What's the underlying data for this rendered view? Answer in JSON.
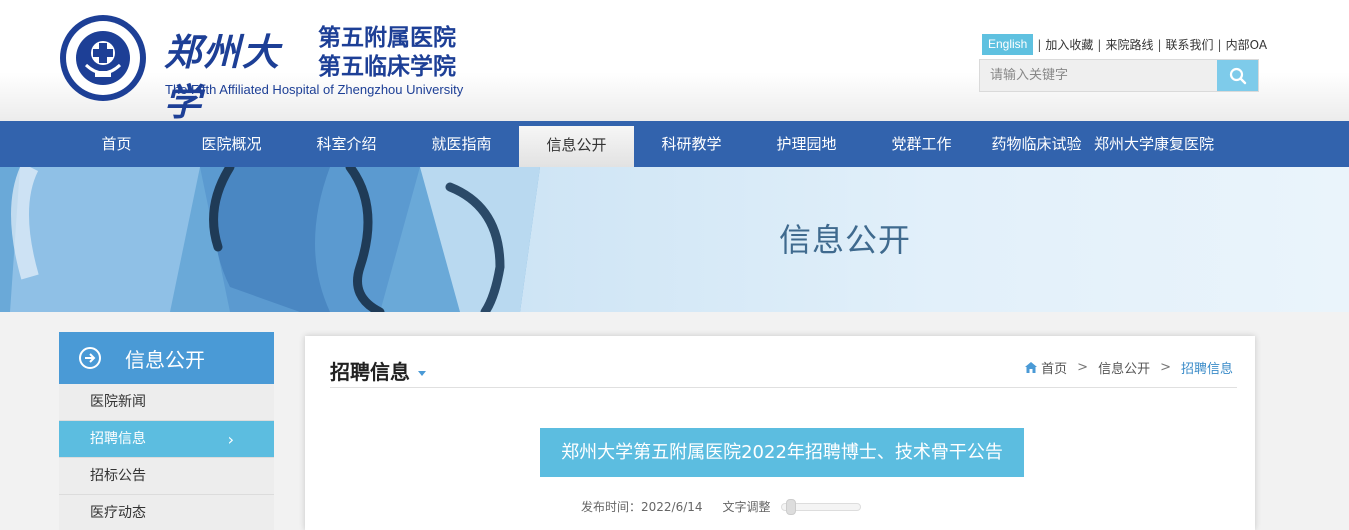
{
  "header": {
    "logo_cn": "郑州大学",
    "logo_hospital_line1": "第五附属医院",
    "logo_hospital_line2": "第五临床学院",
    "logo_en": "The Fifth Affiliated Hospital of Zhengzhou University",
    "toplinks": {
      "english": "English",
      "favorite": "加入收藏",
      "route": "来院路线",
      "contact": "联系我们",
      "oa": "内部OA"
    },
    "search": {
      "placeholder": "请输入关键字"
    }
  },
  "nav": {
    "items": [
      {
        "label": "首页"
      },
      {
        "label": "医院概况"
      },
      {
        "label": "科室介绍"
      },
      {
        "label": "就医指南"
      },
      {
        "label": "信息公开"
      },
      {
        "label": "科研教学"
      },
      {
        "label": "护理园地"
      },
      {
        "label": "党群工作"
      },
      {
        "label": "药物临床试验"
      },
      {
        "label": "郑州大学康复医院"
      }
    ]
  },
  "banner": {
    "title": "信息公开"
  },
  "sidebar": {
    "heading": "信息公开",
    "items": [
      {
        "label": "医院新闻"
      },
      {
        "label": "招聘信息"
      },
      {
        "label": "招标公告"
      },
      {
        "label": "医疗动态"
      }
    ]
  },
  "main": {
    "section_title": "招聘信息",
    "breadcrumb": {
      "home": "首页",
      "parent": "信息公开",
      "current": "招聘信息"
    },
    "article_title": "郑州大学第五附属医院2022年招聘博士、技术骨干公告",
    "publish_label": "发布时间：",
    "publish_date": "2022/6/14",
    "font_adjust_label": "文字调整"
  },
  "colors": {
    "nav_bg": "#3263ad",
    "accent": "#5cbde0",
    "brand_text": "#1d3f96"
  }
}
